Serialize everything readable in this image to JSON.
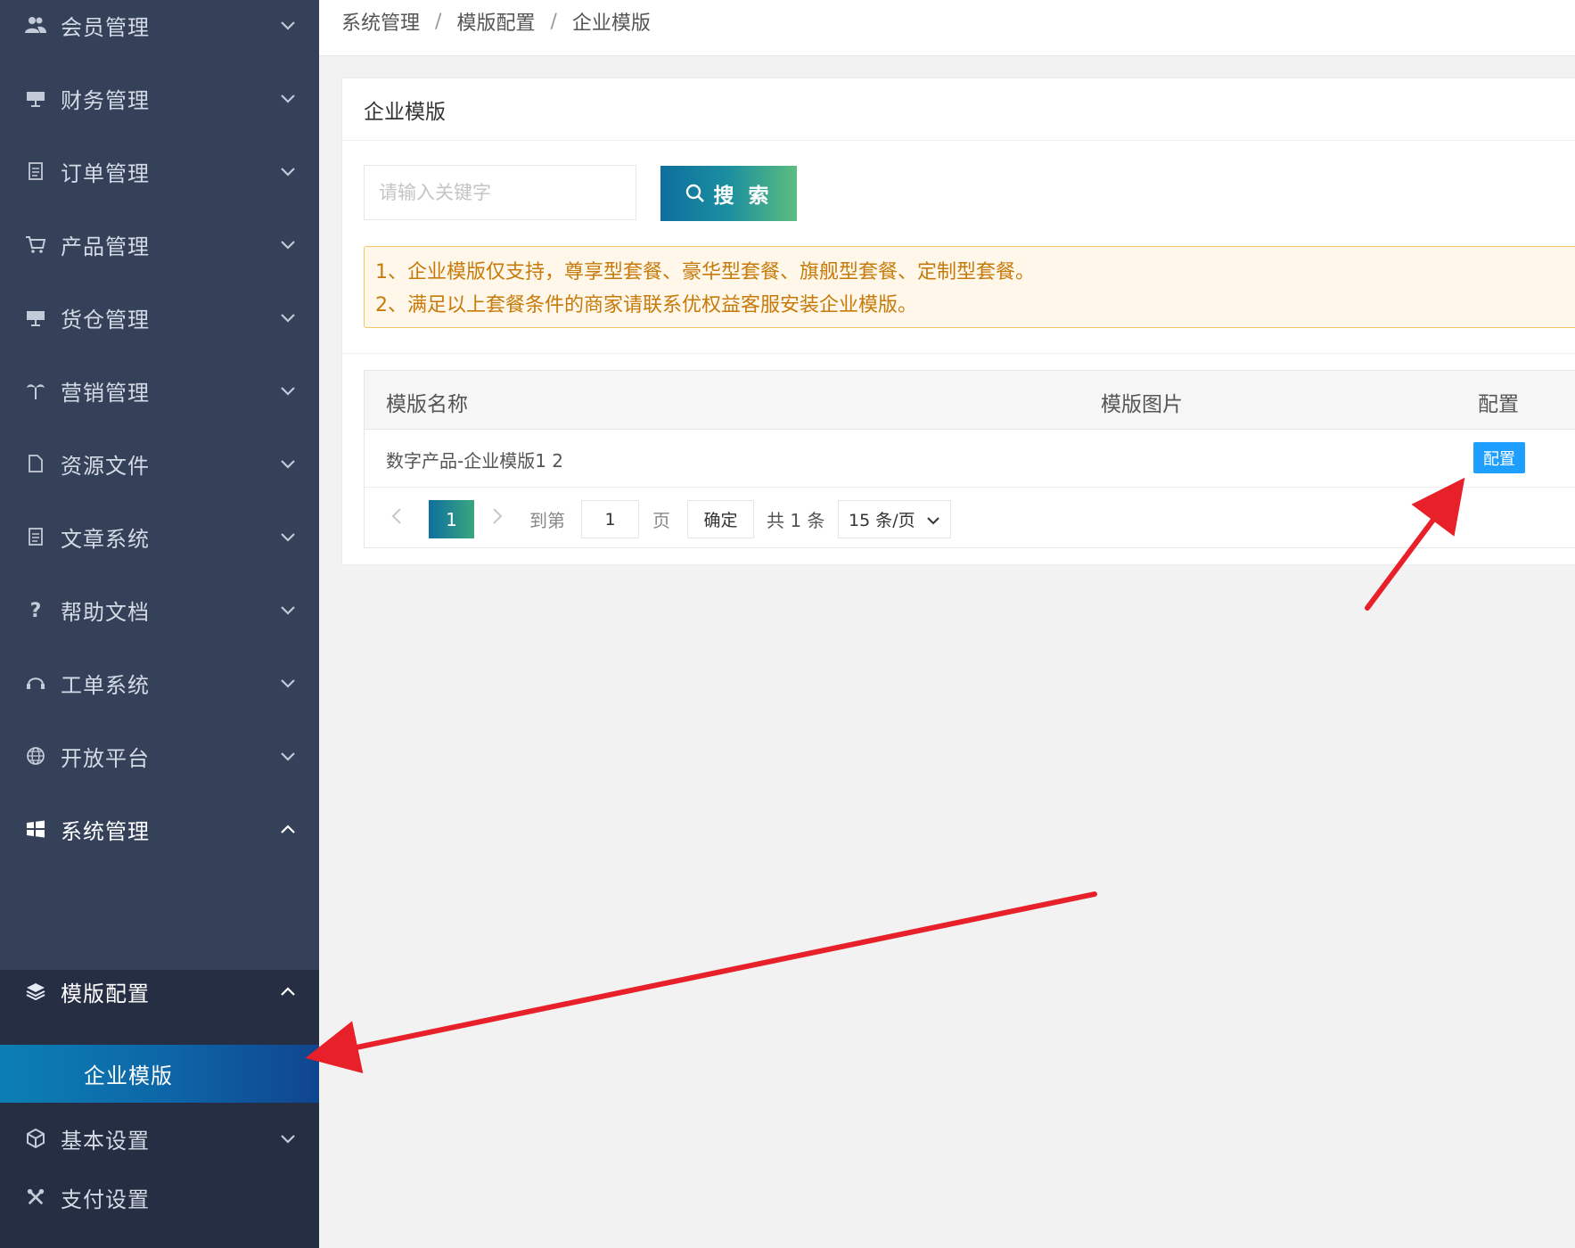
{
  "sidebar": {
    "items": [
      {
        "label": "会员管理",
        "icon": "users-icon",
        "expanded": false
      },
      {
        "label": "财务管理",
        "icon": "finance-icon",
        "expanded": false
      },
      {
        "label": "订单管理",
        "icon": "document-icon",
        "expanded": false
      },
      {
        "label": "产品管理",
        "icon": "cart-icon",
        "expanded": false
      },
      {
        "label": "货仓管理",
        "icon": "warehouse-icon",
        "expanded": false
      },
      {
        "label": "营销管理",
        "icon": "palm-icon",
        "expanded": false
      },
      {
        "label": "资源文件",
        "icon": "file-icon",
        "expanded": false
      },
      {
        "label": "文章系统",
        "icon": "article-icon",
        "expanded": false
      },
      {
        "label": "帮助文档",
        "icon": "question-icon",
        "expanded": false
      },
      {
        "label": "工单系统",
        "icon": "headset-icon",
        "expanded": false
      },
      {
        "label": "开放平台",
        "icon": "globe-icon",
        "expanded": false
      },
      {
        "label": "系统管理",
        "icon": "windows-icon",
        "expanded": true
      }
    ],
    "submenu": {
      "group_label": "模版配置",
      "group_icon": "layers-icon",
      "active_item": "企业模版"
    },
    "after_items": [
      {
        "label": "基本设置",
        "icon": "cube-icon"
      },
      {
        "label": "支付设置",
        "icon": "tools-icon"
      }
    ]
  },
  "breadcrumb": [
    "系统管理",
    "模版配置",
    "企业模版"
  ],
  "breadcrumb_separator": "/",
  "card": {
    "title": "企业模版",
    "search": {
      "placeholder": "请输入关键字",
      "value": "",
      "button_label": "搜 索",
      "button_icon": "search-icon"
    },
    "notice": [
      "1、企业模版仅支持，尊享型套餐、豪华型套餐、旗舰型套餐、定制型套餐。",
      "2、满足以上套餐条件的商家请联系优权益客服安装企业模版。"
    ],
    "table": {
      "columns": [
        "模版名称",
        "模版图片",
        "配置"
      ],
      "rows": [
        {
          "name": "数字产品-企业模版1 2",
          "image": "",
          "action": "配置"
        }
      ]
    },
    "pagination": {
      "current_page": "1",
      "goto_label": "到第",
      "goto_value": "1",
      "page_label": "页",
      "confirm_label": "确定",
      "total_label": "共 1 条",
      "page_size": "15 条/页"
    }
  },
  "colors": {
    "sidebar_bg": "#354159",
    "sidebar_sub_bg": "#252e42",
    "active_gradient_start": "#0c7fb4",
    "search_gradient_end": "#5bbd7e",
    "notice_text": "#c77a0a",
    "config_button": "#1e9fff",
    "annotation_arrow": "#e8202a"
  }
}
